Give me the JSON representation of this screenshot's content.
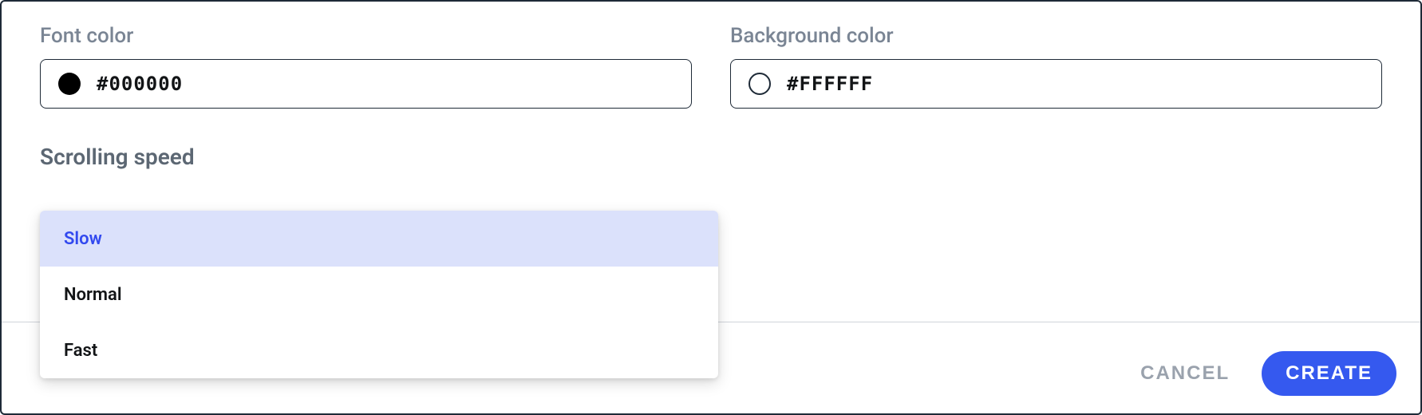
{
  "fields": {
    "font_color": {
      "label": "Font color",
      "value": "#000000",
      "swatch": "#000000"
    },
    "background_color": {
      "label": "Background color",
      "value": "#FFFFFF",
      "swatch": "#FFFFFF"
    }
  },
  "scrolling_speed": {
    "label": "Scrolling speed",
    "options": [
      {
        "label": "Slow",
        "selected": true
      },
      {
        "label": "Normal",
        "selected": false
      },
      {
        "label": "Fast",
        "selected": false
      }
    ]
  },
  "footer": {
    "cancel_label": "CANCEL",
    "create_label": "CREATE"
  }
}
